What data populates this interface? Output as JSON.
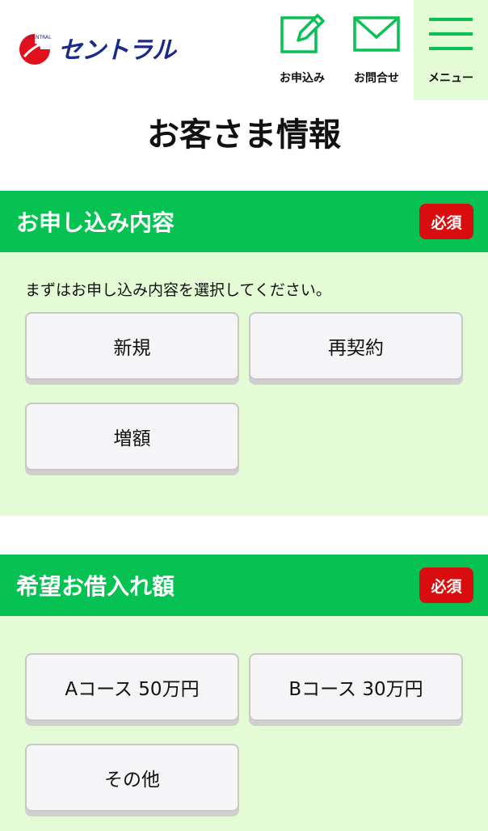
{
  "header": {
    "logo_text": "セントラル",
    "logo_mark_text": "CENTRAL",
    "nav": [
      {
        "label": "お申込み",
        "icon": "edit-icon"
      },
      {
        "label": "お問合せ",
        "icon": "mail-icon"
      },
      {
        "label": "メニュー",
        "icon": "hamburger-icon"
      }
    ]
  },
  "page": {
    "title": "お客さま情報"
  },
  "sections": [
    {
      "title": "お申し込み内容",
      "badge": "必須",
      "description": "まずはお申し込み内容を選択してください。",
      "options": [
        "新規",
        "再契約",
        "増額"
      ]
    },
    {
      "title": "希望お借入れ額",
      "badge": "必須",
      "options": [
        "Aコース 50万円",
        "Bコース 30万円",
        "その他"
      ]
    }
  ],
  "colors": {
    "accent_green": "#06c252",
    "light_green_bg": "#e4fcd6",
    "badge_red": "#d90d0d",
    "logo_navy": "#1a2a8c"
  }
}
